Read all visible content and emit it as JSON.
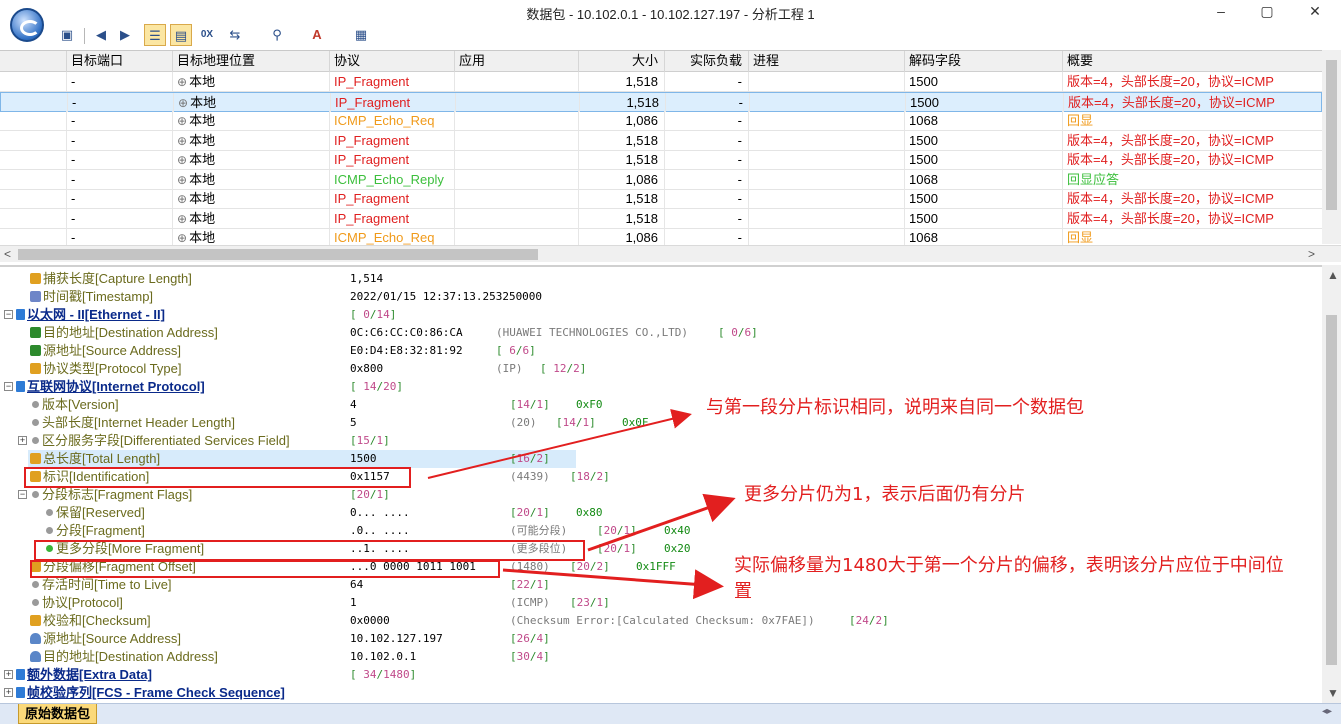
{
  "window": {
    "title": "数据包 - 10.102.0.1 - 10.102.127.197 - 分析工程 1",
    "minimize": "–",
    "maximize": "▢",
    "close": "✕"
  },
  "toolbar": {
    "icons": [
      "save-icon",
      "back-arrow-icon",
      "forward-arrow-icon",
      "decode-view-icon",
      "field-view-icon",
      "hex-view-icon",
      "goto-packet-icon",
      "filter-icon",
      "font-icon",
      "export-icon"
    ]
  },
  "packet_list": {
    "columns": [
      "目标端口",
      "目标地理位置",
      "协议",
      "应用",
      "大小",
      "实际负载",
      "进程",
      "解码字段",
      "概要"
    ],
    "rows": [
      {
        "port": "-",
        "geo": "本地",
        "proto": "IP_Fragment",
        "proto_color": "#e01f1f",
        "size": "1,518",
        "payload": "-",
        "decode": "1500",
        "summary": "版本=4，头部长度=20，协议=ICMP",
        "summary_color": "#e01f1f"
      },
      {
        "port": "-",
        "geo": "本地",
        "proto": "IP_Fragment",
        "proto_color": "#e01f1f",
        "size": "1,518",
        "payload": "-",
        "decode": "1500",
        "summary": "版本=4，头部长度=20，协议=ICMP",
        "summary_color": "#e01f1f"
      },
      {
        "port": "-",
        "geo": "本地",
        "proto": "ICMP_Echo_Req",
        "proto_color": "#f09a1a",
        "size": "1,086",
        "payload": "-",
        "decode": "1068",
        "summary": "回显",
        "summary_color": "#f09a1a"
      },
      {
        "port": "-",
        "geo": "本地",
        "proto": "IP_Fragment",
        "proto_color": "#e01f1f",
        "size": "1,518",
        "payload": "-",
        "decode": "1500",
        "summary": "版本=4，头部长度=20，协议=ICMP",
        "summary_color": "#e01f1f"
      },
      {
        "port": "-",
        "geo": "本地",
        "proto": "IP_Fragment",
        "proto_color": "#e01f1f",
        "size": "1,518",
        "payload": "-",
        "decode": "1500",
        "summary": "版本=4，头部长度=20，协议=ICMP",
        "summary_color": "#e01f1f"
      },
      {
        "port": "-",
        "geo": "本地",
        "proto": "ICMP_Echo_Reply",
        "proto_color": "#3cbf3c",
        "size": "1,086",
        "payload": "-",
        "decode": "1068",
        "summary": "回显应答",
        "summary_color": "#3cbf3c"
      },
      {
        "port": "-",
        "geo": "本地",
        "proto": "IP_Fragment",
        "proto_color": "#e01f1f",
        "size": "1,518",
        "payload": "-",
        "decode": "1500",
        "summary": "版本=4，头部长度=20，协议=ICMP",
        "summary_color": "#e01f1f"
      },
      {
        "port": "-",
        "geo": "本地",
        "proto": "IP_Fragment",
        "proto_color": "#e01f1f",
        "size": "1,518",
        "payload": "-",
        "decode": "1500",
        "summary": "版本=4，头部长度=20，协议=ICMP",
        "summary_color": "#e01f1f"
      },
      {
        "port": "-",
        "geo": "本地",
        "proto": "ICMP_Echo_Req",
        "proto_color": "#f09a1a",
        "size": "1,086",
        "payload": "-",
        "decode": "1068",
        "summary": "回显",
        "summary_color": "#f09a1a"
      }
    ],
    "selected_row": 1
  },
  "decode": {
    "capture_length": {
      "label": "捕获长度[Capture Length]",
      "value": "1,514"
    },
    "timestamp": {
      "label": "时间戳[Timestamp]",
      "value": "2022/01/15 12:37:13.253250000"
    },
    "ethernet": {
      "label": "以太网 - II[Ethernet - II]",
      "range_a": "0",
      "range_b": "14"
    },
    "eth_dst": {
      "label": "目的地址[Destination Address]",
      "value": "0C:C6:CC:C0:86:CA",
      "extra": "(HUAWEI TECHNOLOGIES CO.,LTD)",
      "range_a": "0",
      "range_b": "6"
    },
    "eth_src": {
      "label": "源地址[Source Address]",
      "value": "E0:D4:E8:32:81:92",
      "range_a": "6",
      "range_b": "6"
    },
    "eth_type": {
      "label": "协议类型[Protocol Type]",
      "value": "0x800",
      "extra": "(IP)",
      "range_a": "12",
      "range_b": "2"
    },
    "ip": {
      "label": "互联网协议[Internet Protocol]",
      "range_a": "14",
      "range_b": "20"
    },
    "version": {
      "label": "版本[Version]",
      "value": "4",
      "range_a": "14",
      "range_b": "1",
      "hex": "0xF0"
    },
    "ihl": {
      "label": "头部长度[Internet Header Length]",
      "value": "5",
      "extra": "(20)",
      "range_a": "14",
      "range_b": "1",
      "hex": "0x0F"
    },
    "dsf": {
      "label": "区分服务字段[Differentiated Services Field]",
      "range_a": "15",
      "range_b": "1"
    },
    "total_length": {
      "label": "总长度[Total Length]",
      "value": "1500",
      "range_a": "16",
      "range_b": "2"
    },
    "identification": {
      "label": "标识[Identification]",
      "value": "0x1157",
      "extra": "(4439)",
      "range_a": "18",
      "range_b": "2"
    },
    "frag_flags": {
      "label": "分段标志[Fragment Flags]",
      "range_a": "20",
      "range_b": "1"
    },
    "reserved": {
      "label": "保留[Reserved]",
      "value": "0... ....",
      "range_a": "20",
      "range_b": "1",
      "hex": "0x80"
    },
    "fragment": {
      "label": "分段[Fragment]",
      "value": ".0.. ....",
      "extra": "(可能分段)",
      "range_a": "20",
      "range_b": "1",
      "hex": "0x40"
    },
    "more_fragment": {
      "label": "更多分段[More Fragment]",
      "value": "..1. ....",
      "extra": "(更多段位)",
      "range_a": "20",
      "range_b": "1",
      "hex": "0x20"
    },
    "frag_offset": {
      "label": "分段偏移[Fragment Offset]",
      "value": "...0 0000 1011 1001",
      "extra": "(1480)",
      "range_a": "20",
      "range_b": "2",
      "hex": "0x1FFF"
    },
    "ttl": {
      "label": "存活时间[Time to Live]",
      "value": "64",
      "range_a": "22",
      "range_b": "1"
    },
    "protocol": {
      "label": "协议[Protocol]",
      "value": "1",
      "extra": "(ICMP)",
      "range_a": "23",
      "range_b": "1"
    },
    "checksum": {
      "label": "校验和[Checksum]",
      "value": "0x0000",
      "extra": "(Checksum Error:[Calculated Checksum: 0x7FAE])",
      "range_a": "24",
      "range_b": "2"
    },
    "ip_src": {
      "label": "源地址[Source Address]",
      "value": "10.102.127.197",
      "range_a": "26",
      "range_b": "4"
    },
    "ip_dst": {
      "label": "目的地址[Destination Address]",
      "value": "10.102.0.1",
      "range_a": "30",
      "range_b": "4"
    },
    "extra_data": {
      "label": "额外数据[Extra Data]",
      "range_a": "34",
      "range_b": "1480"
    },
    "fcs": {
      "label": "帧校验序列[FCS - Frame Check Sequence]"
    }
  },
  "bottom_tab": {
    "label": "原始数据包"
  },
  "annotations": {
    "note1": "与第一段分片标识相同，说明来自同一个数据包",
    "note2": "更多分片仍为1，表示后面仍有分片",
    "note3_line1": "实际偏移量为1480大于第一个分片的偏移，表明该分片应位于中间位",
    "note3_line2": "置",
    "color": "#e21f1f"
  }
}
